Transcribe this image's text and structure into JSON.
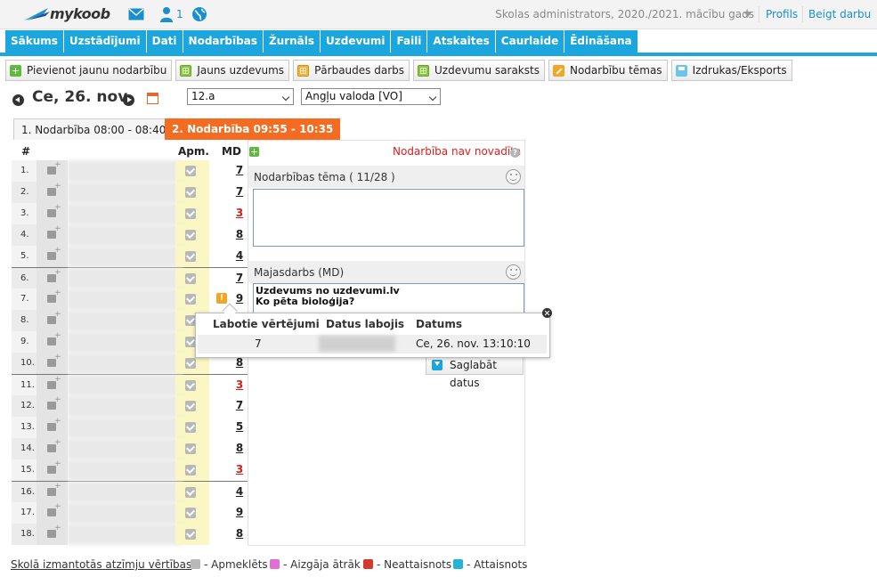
{
  "app": {
    "logo_text": "mykoob",
    "user_count": "1"
  },
  "header": {
    "admin_label": "Skolas administrators, 2020./2021. mācību gads",
    "profile_link": "Profils",
    "logout_link": "Beigt darbu"
  },
  "nav": [
    "Sākums",
    "Uzstādījumi",
    "Dati",
    "Nodarbības",
    "Žurnāls",
    "Uzdevumi",
    "Faili",
    "Atskaites",
    "Caurlaide",
    "Ēdināšana"
  ],
  "toolbar": {
    "add_lesson": "Pievienot jaunu nodarbību",
    "new_task": "Jauns uzdevums",
    "test": "Pārbaudes darbs",
    "task_list": "Uzdevumu saraksts",
    "lesson_topics": "Nodarbību tēmas",
    "print_export": "Izdrukas/Eksports"
  },
  "date": {
    "label": "Ce, 26. nov."
  },
  "filters": {
    "class": "12.a",
    "subject": "Angļu valoda [VO]"
  },
  "tabs": [
    "1. Nodarbība 08:00 - 08:40",
    "2. Nodarbība 09:55 - 10:35"
  ],
  "table": {
    "col_num": "#",
    "col_apm": "Apm.",
    "col_md": "MD",
    "rows": [
      {
        "n": "1.",
        "grade": "7",
        "red": false
      },
      {
        "n": "2.",
        "grade": "7",
        "red": false
      },
      {
        "n": "3.",
        "grade": "3",
        "red": true
      },
      {
        "n": "4.",
        "grade": "8",
        "red": false
      },
      {
        "n": "5.",
        "grade": "4",
        "red": false
      },
      {
        "n": "6.",
        "grade": "7",
        "red": false
      },
      {
        "n": "7.",
        "grade": "9",
        "red": false
      },
      {
        "n": "8.",
        "grade": "",
        "red": false
      },
      {
        "n": "9.",
        "grade": "",
        "red": false
      },
      {
        "n": "10.",
        "grade": "8",
        "red": false
      },
      {
        "n": "11.",
        "grade": "3",
        "red": true
      },
      {
        "n": "12.",
        "grade": "7",
        "red": false
      },
      {
        "n": "13.",
        "grade": "5",
        "red": false
      },
      {
        "n": "14.",
        "grade": "8",
        "red": false
      },
      {
        "n": "15.",
        "grade": "3",
        "red": true
      },
      {
        "n": "16.",
        "grade": "4",
        "red": false
      },
      {
        "n": "17.",
        "grade": "9",
        "red": false
      },
      {
        "n": "18.",
        "grade": "8",
        "red": false
      }
    ]
  },
  "status": {
    "not_held": "Nodarbība nav novadīta",
    "help": "?"
  },
  "topic": {
    "label": "Nodarbības tēma ( 11/28 )",
    "value": ""
  },
  "homework": {
    "label": "Majasdarbs (MD)",
    "value": "Uzdevums no uzdevumi.lv\nKo pēta bioloģija?"
  },
  "save_button": "Saglabāt datus",
  "popup": {
    "col_changed": "Labotie vērtējumi",
    "col_who": "Datus labojis",
    "col_date": "Datums",
    "value": "7",
    "date_value": "Ce, 26. nov. 13:10:10"
  },
  "warn_mark": "!",
  "legend": {
    "link": "Skolā izmantotās atzīmju vērtības",
    "items": [
      {
        "label": "- Apmeklēts",
        "color": "#b8b8b8"
      },
      {
        "label": "- Aizgāja ātrāk",
        "color": "#e16fd6"
      },
      {
        "label": "- Neattaisnots",
        "color": "#d33b2c"
      },
      {
        "label": "- Attaisnots",
        "color": "#25b4d8"
      }
    ]
  },
  "colors": {
    "accent": "#1ba6dd",
    "tab_active": "#f36c21",
    "attendance_bg": "#fbf7c4"
  }
}
